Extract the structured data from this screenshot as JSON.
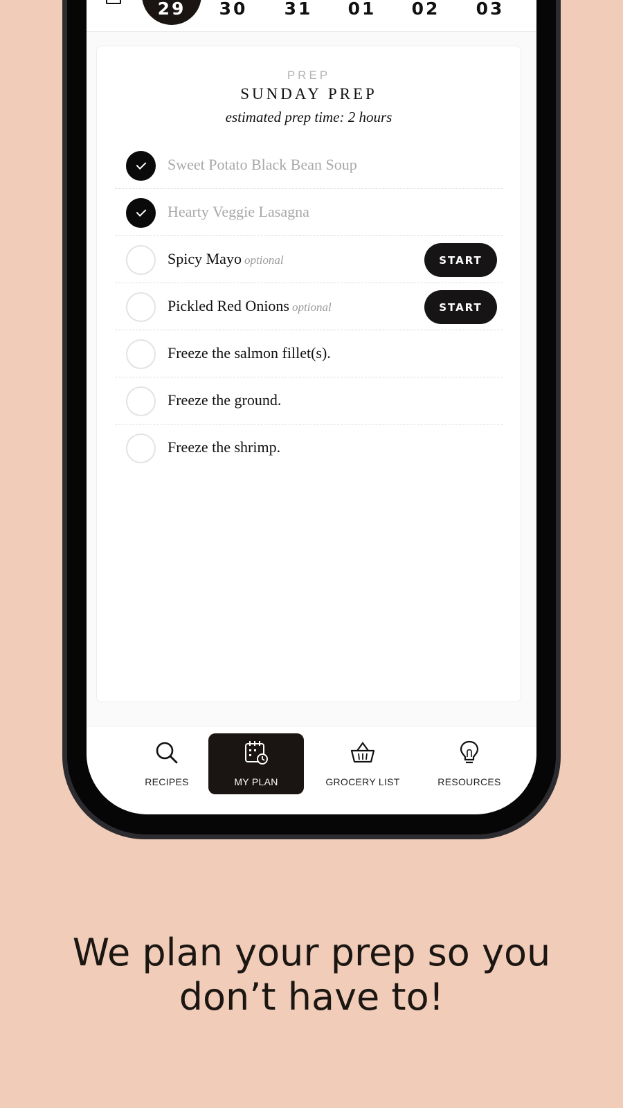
{
  "date_strip": {
    "dates": [
      "29",
      "30",
      "31",
      "01",
      "02",
      "03"
    ],
    "selected": "29"
  },
  "card": {
    "kicker": "PREP",
    "title": "SUNDAY PREP",
    "subtitle": "estimated prep time: 2 hours",
    "items": [
      {
        "label": "Sweet Potato Black Bean Soup",
        "optional": "",
        "done": true,
        "button": ""
      },
      {
        "label": "Hearty Veggie Lasagna",
        "optional": "",
        "done": true,
        "button": ""
      },
      {
        "label": "Spicy Mayo",
        "optional": "optional",
        "done": false,
        "button": "START"
      },
      {
        "label": "Pickled Red Onions",
        "optional": "optional",
        "done": false,
        "button": "START"
      },
      {
        "label": "Freeze the salmon fillet(s).",
        "optional": "",
        "done": false,
        "button": ""
      },
      {
        "label": "Freeze the ground.",
        "optional": "",
        "done": false,
        "button": ""
      },
      {
        "label": "Freeze the shrimp.",
        "optional": "",
        "done": false,
        "button": ""
      }
    ]
  },
  "nav": {
    "items": [
      {
        "label": "RECIPES",
        "icon": "search-icon",
        "active": false
      },
      {
        "label": "MY PLAN",
        "icon": "calendar-clock-icon",
        "active": true
      },
      {
        "label": "GROCERY LIST",
        "icon": "basket-icon",
        "active": false
      },
      {
        "label": "RESOURCES",
        "icon": "lightbulb-icon",
        "active": false
      }
    ]
  },
  "tagline": "We plan your prep so you don’t have to!",
  "colors": {
    "background": "#f1cdb9",
    "dark": "#1a1513",
    "muted_text": "#a8a8a8"
  }
}
